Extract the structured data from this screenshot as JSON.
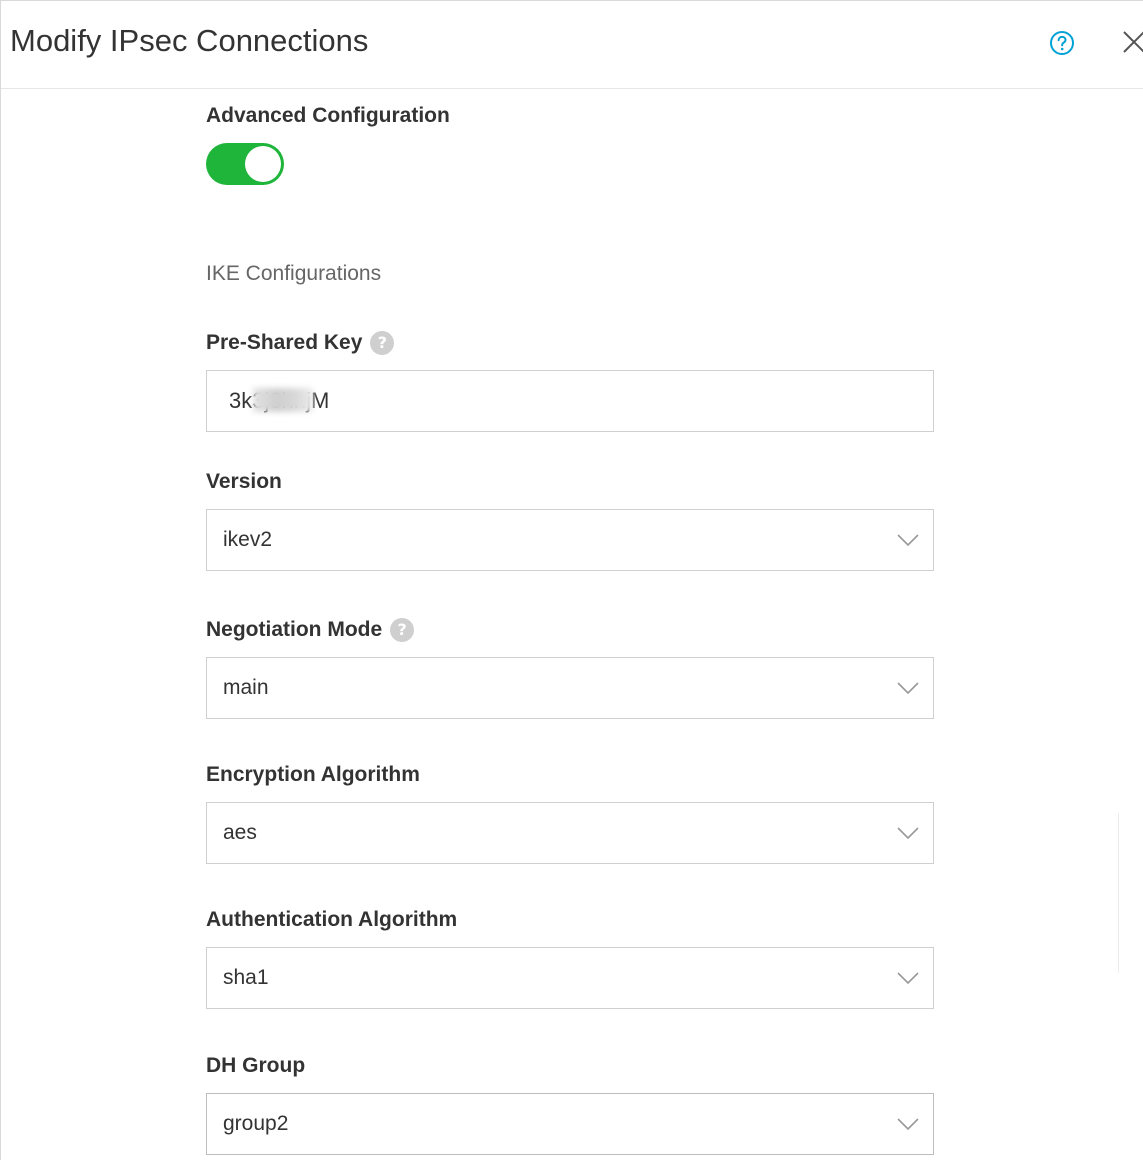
{
  "dialog": {
    "title": "Modify IPsec Connections",
    "help_icon": "question-circle-icon",
    "close_icon": "close-x-icon"
  },
  "advanced": {
    "label": "Advanced Configuration",
    "enabled": true,
    "accent_color": "#1fb43a"
  },
  "ike": {
    "section_title": "IKE Configurations",
    "pre_shared_key": {
      "label": "Pre-Shared Key",
      "value": "3k3j8hnjM",
      "tip_icon": "question-mark-icon"
    },
    "version": {
      "label": "Version",
      "value": "ikev2"
    },
    "negotiation_mode": {
      "label": "Negotiation Mode",
      "value": "main",
      "tip_icon": "question-mark-icon"
    },
    "encryption_algorithm": {
      "label": "Encryption Algorithm",
      "value": "aes"
    },
    "authentication_algorithm": {
      "label": "Authentication Algorithm",
      "value": "sha1"
    },
    "dh_group": {
      "label": "DH Group",
      "value": "group2"
    }
  }
}
